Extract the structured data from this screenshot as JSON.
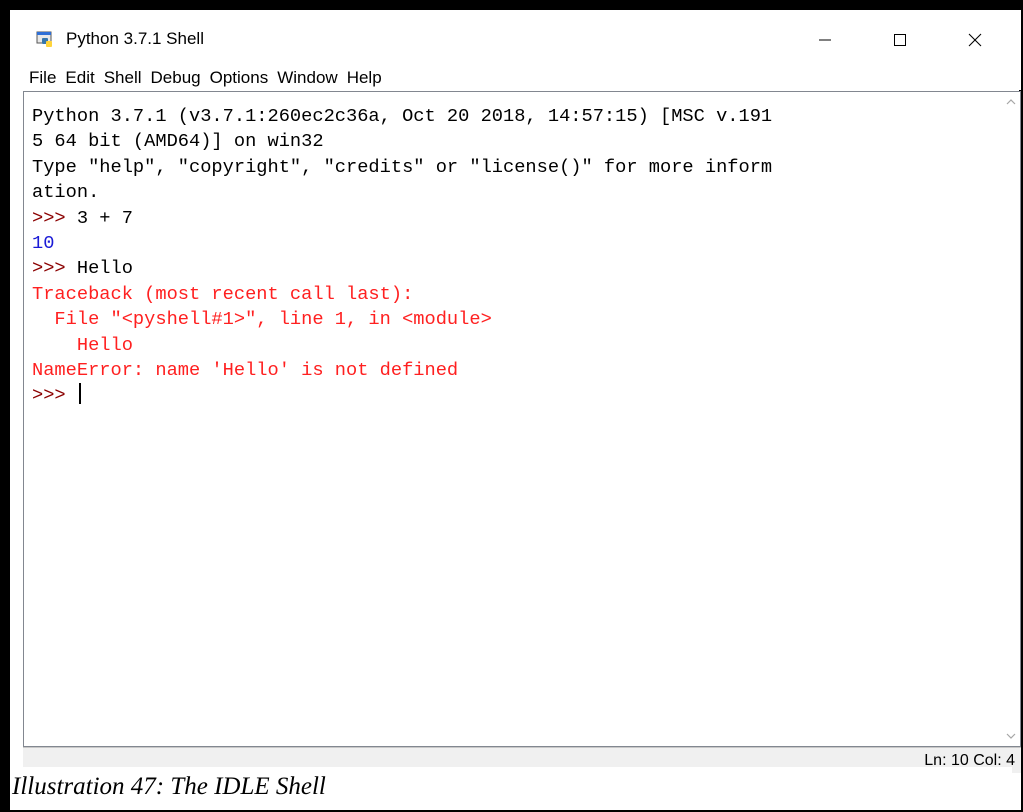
{
  "window": {
    "title": "Python 3.7.1 Shell",
    "icon": "python-idle-icon",
    "controls": {
      "minimize": "minimize-icon",
      "maximize": "maximize-icon",
      "close": "close-icon"
    }
  },
  "menu": {
    "items": [
      "File",
      "Edit",
      "Shell",
      "Debug",
      "Options",
      "Window",
      "Help"
    ]
  },
  "shell": {
    "lines": [
      {
        "type": "normal",
        "text": "Python 3.7.1 (v3.7.1:260ec2c36a, Oct 20 2018, 14:57:15) [MSC v.191"
      },
      {
        "type": "normal",
        "text": "5 64 bit (AMD64)] on win32"
      },
      {
        "type": "normal",
        "text": "Type \"help\", \"copyright\", \"credits\" or \"license()\" for more inform"
      },
      {
        "type": "normal",
        "text": "ation."
      },
      {
        "type": "input",
        "prompt": ">>>",
        "text": " 3 + 7"
      },
      {
        "type": "output",
        "text": "10"
      },
      {
        "type": "input",
        "prompt": ">>>",
        "text": " Hello"
      },
      {
        "type": "error",
        "text": "Traceback (most recent call last):"
      },
      {
        "type": "error",
        "text": "  File \"<pyshell#1>\", line 1, in <module>"
      },
      {
        "type": "error",
        "text": "    Hello"
      },
      {
        "type": "error",
        "text": "NameError: name 'Hello' is not defined"
      },
      {
        "type": "input",
        "prompt": ">>>",
        "text": " ",
        "cursor": true
      }
    ]
  },
  "status": {
    "text": "Ln: 10  Col: 4"
  },
  "caption": {
    "text": "Illustration 47: The IDLE Shell"
  },
  "colors": {
    "prompt": "#8b0000",
    "output": "#1a1ad6",
    "error": "#ff2020",
    "statusbar": "#f0f0f0"
  }
}
